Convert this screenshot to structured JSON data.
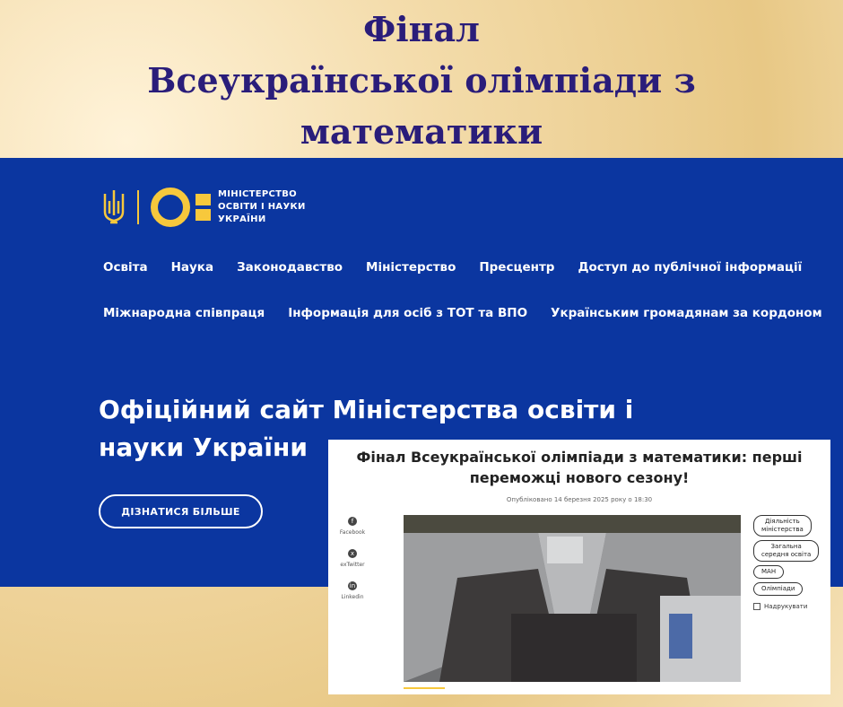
{
  "headline": {
    "line1": "Фінал",
    "line2": "Всеукраїнської олімпіади з",
    "line3": "математики"
  },
  "site": {
    "logo_text": [
      "МІНІСТЕРСТВО",
      "ОСВІТИ І НАУКИ",
      "УКРАЇНИ"
    ],
    "nav_row1": [
      "Освіта",
      "Наука",
      "Законодавство",
      "Міністерство",
      "Пресцентр",
      "Доступ до публічної інформації"
    ],
    "nav_row2": [
      "Міжнародна співпраця",
      "Інформація для осіб з ТОТ та ВПО",
      "Українським громадянам за кордоном"
    ],
    "hero_line1": "Офіційний сайт Міністерства освіти і",
    "hero_line2": "науки України",
    "cta_label": "ДІЗНАТИСЯ БІЛЬШЕ"
  },
  "article": {
    "title_line1": "Фінал Всеукраїнської олімпіади з математики: перші",
    "title_line2": "переможці нового сезону!",
    "published": "Опубліковано 14 березня 2025 року о 18:30",
    "share": [
      {
        "label": "Facebook",
        "icon": "facebook-icon",
        "glyph": "f"
      },
      {
        "label": "exTwitter",
        "icon": "x-icon",
        "glyph": "x"
      },
      {
        "label": "Linkedin",
        "icon": "linkedin-icon",
        "glyph": "in"
      }
    ],
    "tags": [
      "Діяльність\nміністерства",
      "Загальна\nсередня освіта",
      "МАН",
      "Олімпіади"
    ],
    "print_label": "Надрукувати"
  },
  "colors": {
    "brand_blue": "#0b36a0",
    "accent_yellow": "#f7c83c",
    "headline_purple": "#2a1d7a"
  }
}
